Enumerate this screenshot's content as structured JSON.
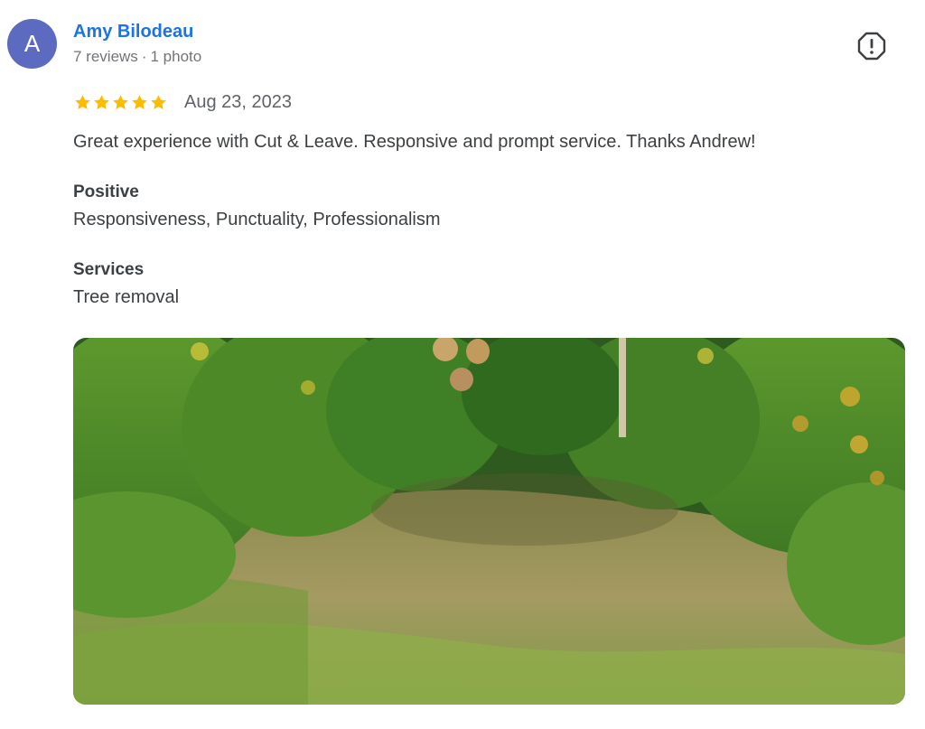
{
  "review": {
    "avatar_letter": "A",
    "author_name": "Amy Bilodeau",
    "reviews_count": "7 reviews",
    "separator": "·",
    "photos_count": "1 photo",
    "rating": 5,
    "max_rating": 5,
    "date": "Aug 23, 2023",
    "text": "Great experience with Cut & Leave. Responsive and prompt service. Thanks Andrew!",
    "positive_label": "Positive",
    "positive_value": "Responsiveness, Punctuality, Professionalism",
    "services_label": "Services",
    "services_value": "Tree removal"
  },
  "colors": {
    "avatar_bg": "#5c6bc0",
    "author_link": "#1a73e8",
    "star": "#fbbc04"
  },
  "icons": {
    "report": "report-flag-icon",
    "star": "star-icon"
  }
}
